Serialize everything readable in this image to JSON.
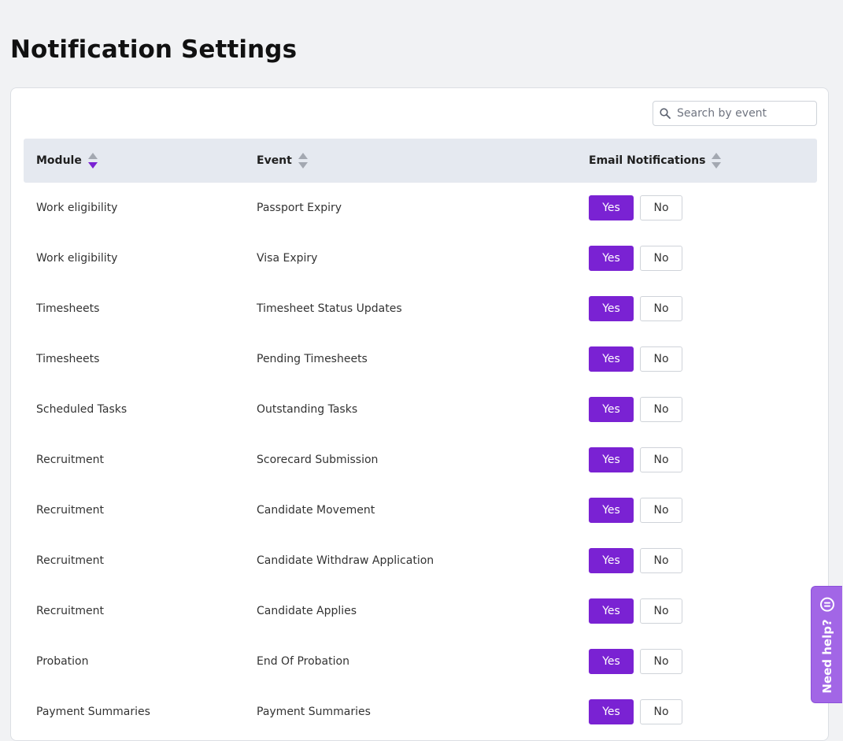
{
  "page": {
    "title": "Notification Settings"
  },
  "search": {
    "placeholder": "Search by event",
    "value": ""
  },
  "table": {
    "columns": [
      {
        "label": "Module",
        "sort": "descending"
      },
      {
        "label": "Event",
        "sort": "none"
      },
      {
        "label": "Email Notifications",
        "sort": "none"
      }
    ],
    "yes_label": "Yes",
    "no_label": "No",
    "rows": [
      {
        "module": "Work eligibility",
        "event": "Passport Expiry",
        "email": "Yes"
      },
      {
        "module": "Work eligibility",
        "event": "Visa Expiry",
        "email": "Yes"
      },
      {
        "module": "Timesheets",
        "event": "Timesheet Status Updates",
        "email": "Yes"
      },
      {
        "module": "Timesheets",
        "event": "Pending Timesheets",
        "email": "Yes"
      },
      {
        "module": "Scheduled Tasks",
        "event": "Outstanding Tasks",
        "email": "Yes"
      },
      {
        "module": "Recruitment",
        "event": "Scorecard Submission",
        "email": "Yes"
      },
      {
        "module": "Recruitment",
        "event": "Candidate Movement",
        "email": "Yes"
      },
      {
        "module": "Recruitment",
        "event": "Candidate Withdraw Application",
        "email": "Yes"
      },
      {
        "module": "Recruitment",
        "event": "Candidate Applies",
        "email": "Yes"
      },
      {
        "module": "Probation",
        "event": "End Of Probation",
        "email": "Yes"
      },
      {
        "module": "Payment Summaries",
        "event": "Payment Summaries",
        "email": "Yes"
      }
    ]
  },
  "help": {
    "label": "Need help?",
    "icon": "chat-icon"
  },
  "colors": {
    "accent": "#7a22d3",
    "sort_active": "#7a22d3",
    "sort_inactive": "#a3a8b1",
    "help_tab": "#a266e6",
    "header_bg": "#e5e9f0",
    "page_bg": "#f1f2f4"
  }
}
